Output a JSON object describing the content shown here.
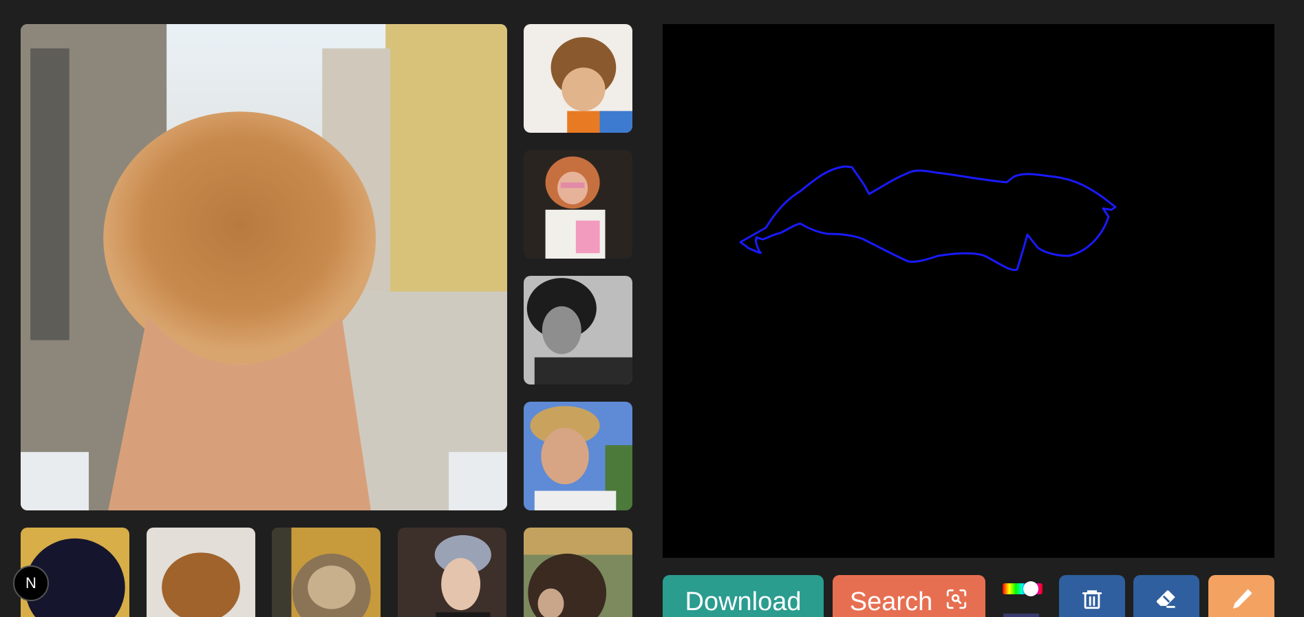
{
  "colors": {
    "background": "#1f1f1f",
    "canvas_bg": "#000000",
    "stroke": "#1a1aff",
    "download": "#2a9d8f",
    "search": "#e76f51",
    "delete": "#2f5f9e",
    "eraser": "#2f5f9e",
    "pencil": "#f4a261"
  },
  "gallery": {
    "main": {
      "icon": "curly-hair-back-photo"
    },
    "side": [
      {
        "icon": "curly-child-photo"
      },
      {
        "icon": "curly-girl-glasses-photo"
      },
      {
        "icon": "curly-man-bw-photo"
      },
      {
        "icon": "blonde-man-photo"
      }
    ],
    "bottom": [
      {
        "icon": "dark-curly-back-photo"
      },
      {
        "icon": "brown-curly-back-photo"
      },
      {
        "icon": "highlighted-curly-back-photo"
      },
      {
        "icon": "silver-hair-man-photo"
      },
      {
        "icon": "curly-side-photo"
      }
    ]
  },
  "toolbar": {
    "download_label": "Download",
    "search_label": "Search",
    "search_icon": "scan-search-icon",
    "delete_icon": "trash-icon",
    "eraser_icon": "eraser-icon",
    "pencil_icon": "pencil-icon",
    "color_picker": "hue-slider"
  },
  "badge": {
    "label": "N"
  }
}
